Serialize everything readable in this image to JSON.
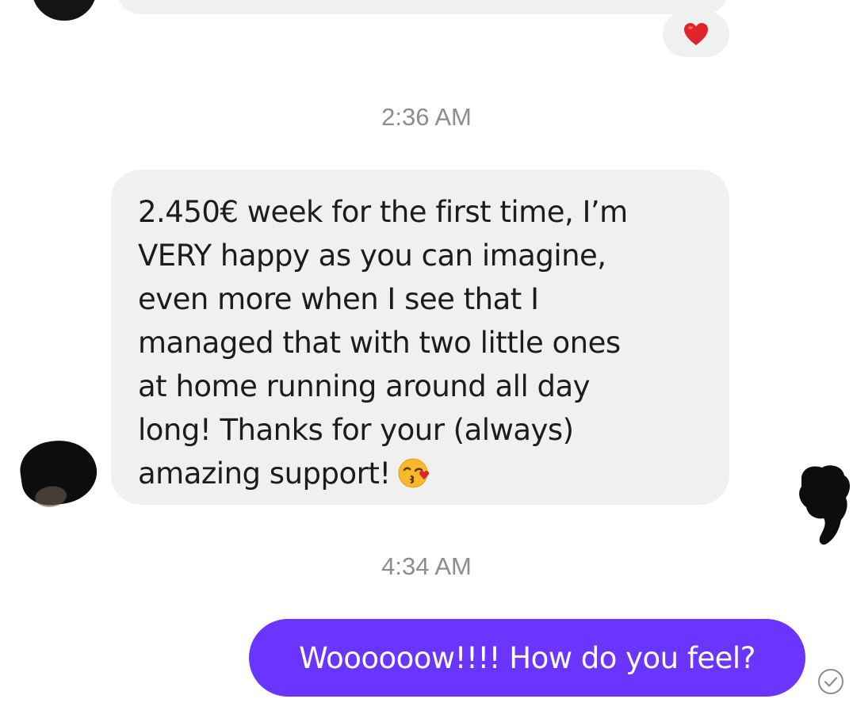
{
  "conversation": {
    "reaction": {
      "icon": "heart-icon",
      "color": "#e0242b"
    },
    "timestamps": [
      "2:36 AM",
      "4:34 AM"
    ],
    "incoming_message": {
      "lines": [
        "2.450€ week for the first time, I’m",
        "VERY happy as you can imagine,",
        "even more when I see that I",
        "managed that with two little ones",
        "at home running around all day",
        "long! Thanks for your (always)",
        "amazing support!"
      ],
      "emoji": "face-blowing-a-kiss-icon"
    },
    "outgoing_message": {
      "text": "Woooooow!!!! How do you feel?"
    },
    "status_icon": "seen-check-icon",
    "colors": {
      "incoming_bubble": "#f0f0f0",
      "outgoing_bubble": "#6a35ff",
      "timestamp": "#8a8d91"
    }
  }
}
